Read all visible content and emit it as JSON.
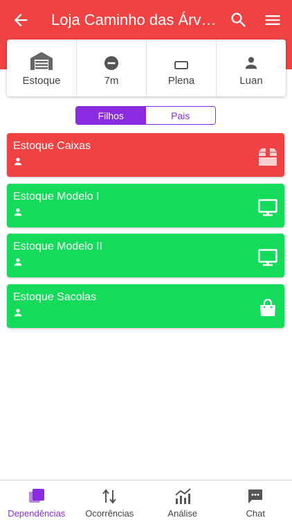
{
  "header": {
    "title": "Loja Caminho das Árvores",
    "back_icon": "arrow-left-icon",
    "search_icon": "search-icon",
    "menu_icon": "hamburger-menu-icon",
    "color": "#f04242"
  },
  "info": [
    {
      "label": "Estoque",
      "icon": "warehouse-icon"
    },
    {
      "label": "7m",
      "icon": "minus-circle-icon"
    },
    {
      "label": "Plena",
      "icon": "rectangle-outline-icon"
    },
    {
      "label": "Luan",
      "icon": "person-icon"
    }
  ],
  "segment": {
    "children_label": "Filhos",
    "parents_label": "Pais",
    "selected": "Filhos",
    "accent": "#8a2be2"
  },
  "items": [
    {
      "title": "Estoque Caixas",
      "icon": "box-icon",
      "status_color": "#f04242"
    },
    {
      "title": "Estoque Modelo I",
      "icon": "monitor-icon",
      "status_color": "#14dc5a"
    },
    {
      "title": "Estoque Modelo II",
      "icon": "monitor-icon",
      "status_color": "#14dc5a"
    },
    {
      "title": "Estoque Sacolas",
      "icon": "shopping-bag-icon",
      "status_color": "#14dc5a"
    }
  ],
  "bottom_nav": [
    {
      "label": "Dependências",
      "icon": "layers-icon",
      "active": true
    },
    {
      "label": "Ocorrências",
      "icon": "swap-vertical-icon",
      "active": false
    },
    {
      "label": "Análise",
      "icon": "analytics-icon",
      "active": false
    },
    {
      "label": "Chat",
      "icon": "chat-icon",
      "active": false
    }
  ]
}
